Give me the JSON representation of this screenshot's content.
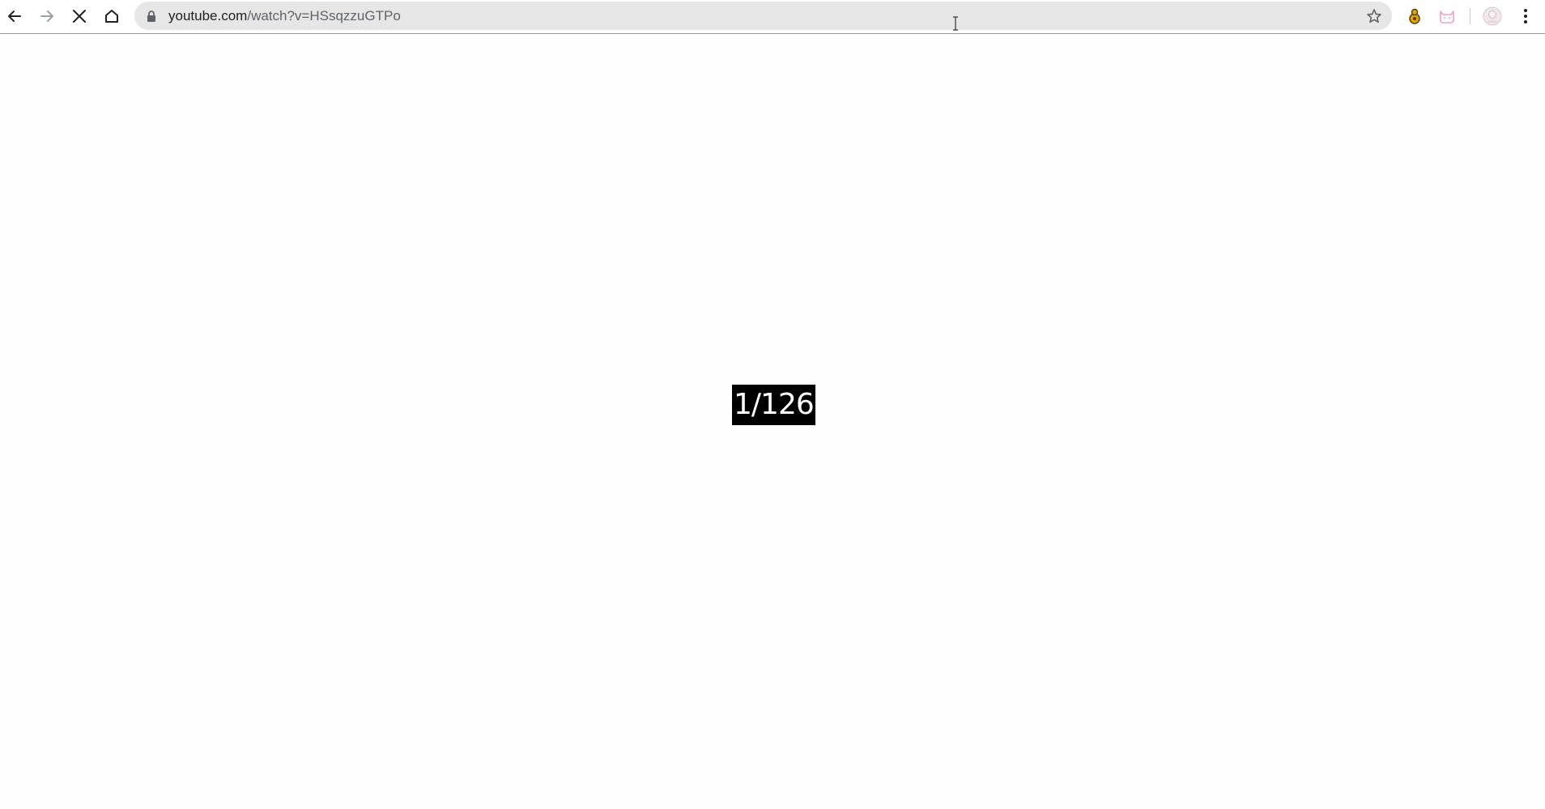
{
  "browser": {
    "url_domain": "youtube.com",
    "url_path": "/watch?v=HSsqzzuGTPo",
    "icons": {
      "back": "back-arrow-icon",
      "forward": "forward-arrow-icon",
      "stop": "stop-loading-icon",
      "home": "home-icon",
      "lock": "lock-icon",
      "bookmark": "star-icon",
      "extension_1": "extension-icon",
      "extension_2": "cat-extension-icon",
      "profile": "avatar-icon",
      "menu": "kebab-menu-icon"
    },
    "colors": {
      "omnibox_bg": "#e6e6e6",
      "extension_2_color": "#f4a0b8"
    }
  },
  "page": {
    "counter_text": "1/126",
    "background": "#fefefe"
  }
}
